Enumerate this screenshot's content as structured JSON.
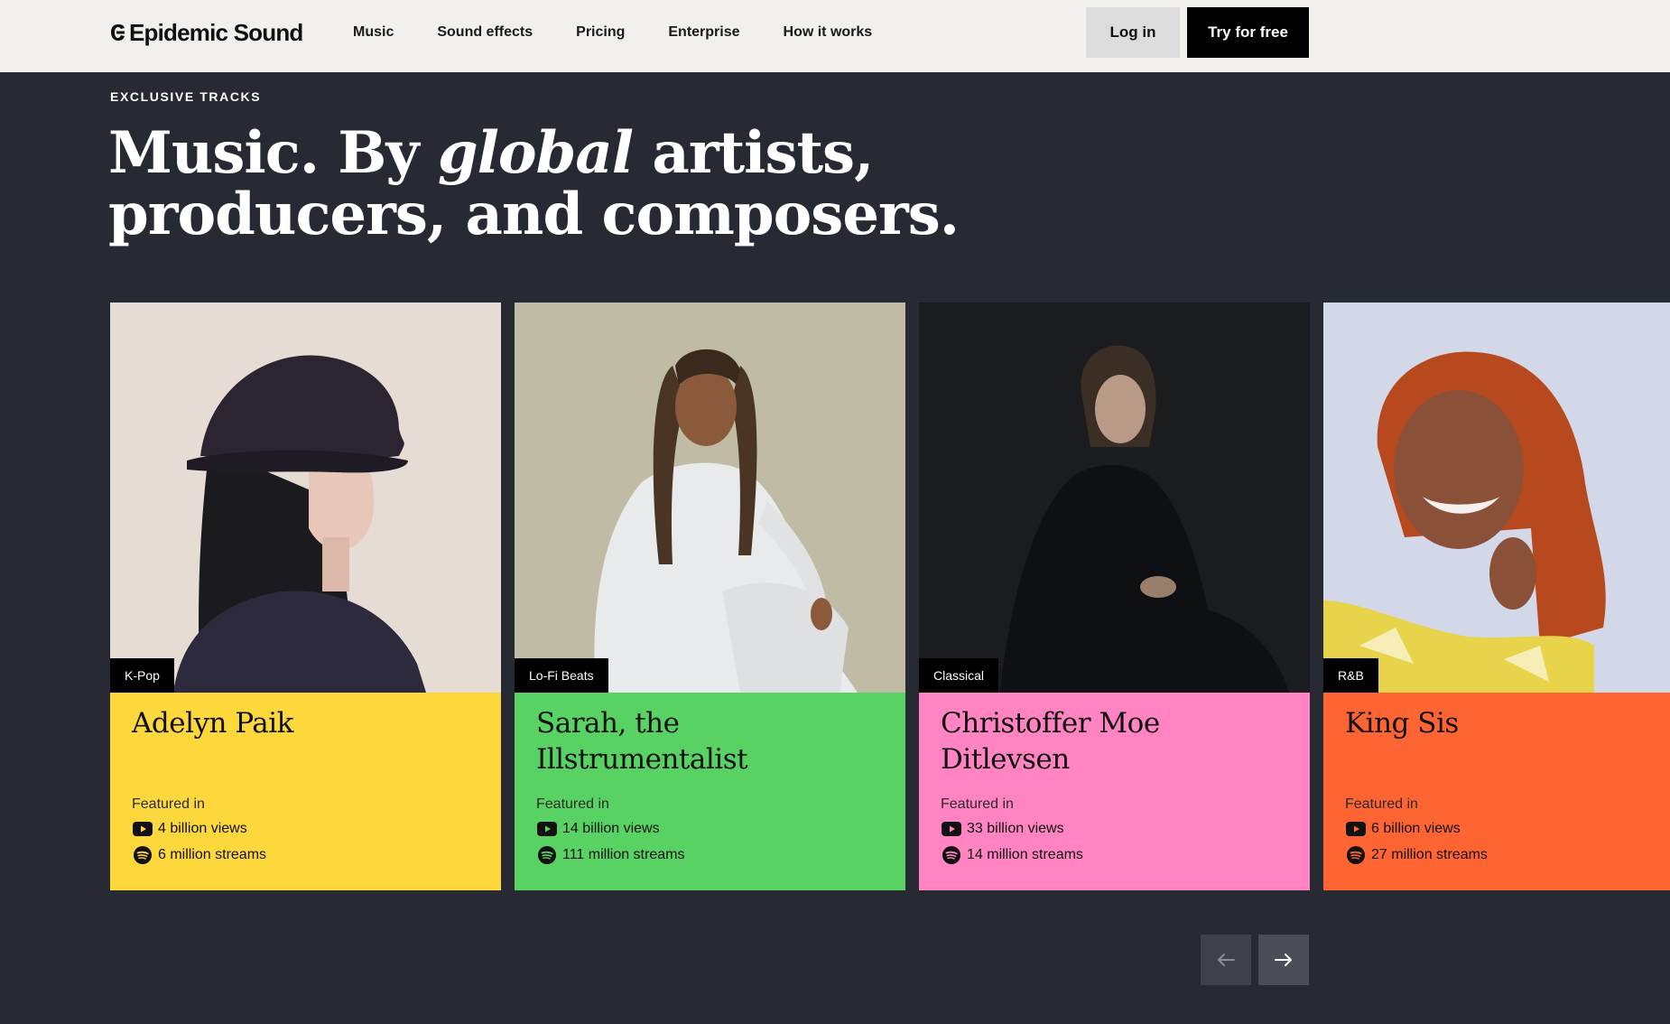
{
  "header": {
    "brand": "Epidemic Sound",
    "nav": [
      "Music",
      "Sound effects",
      "Pricing",
      "Enterprise",
      "How it works"
    ],
    "login_label": "Log in",
    "try_label": "Try for free"
  },
  "hero": {
    "eyebrow": "EXCLUSIVE TRACKS",
    "headline_part1": "Music. By ",
    "headline_italic": "global",
    "headline_part2": " artists,",
    "headline_line2": "producers, and composers."
  },
  "cards": [
    {
      "genre": "K-Pop",
      "name": "Adelyn Paik",
      "featured_label": "Featured in",
      "views": "4 billion views",
      "streams": "6 million streams",
      "bg_color": "#fdd83d",
      "photo_bg": "#e5ddd3"
    },
    {
      "genre": "Lo-Fi Beats",
      "name": "Sarah, the Illstrumentalist",
      "featured_label": "Featured in",
      "views": "14 billion views",
      "streams": "111 million streams",
      "bg_color": "#58d363",
      "photo_bg": "#bfbba5"
    },
    {
      "genre": "Classical",
      "name": "Christoffer Moe Ditlevsen",
      "featured_label": "Featured in",
      "views": "33 billion views",
      "streams": "14 million streams",
      "bg_color": "#ff84c1",
      "photo_bg": "#1b1c20"
    },
    {
      "genre": "R&B",
      "name": "King Sis",
      "featured_label": "Featured in",
      "views": "6 billion views",
      "streams": "27 million streams",
      "bg_color": "#ff6433",
      "photo_bg": "#d3d8e8"
    }
  ],
  "icons": {
    "views": "youtube-icon",
    "streams": "spotify-icon",
    "prev": "arrow-left-icon",
    "next": "arrow-right-icon"
  }
}
